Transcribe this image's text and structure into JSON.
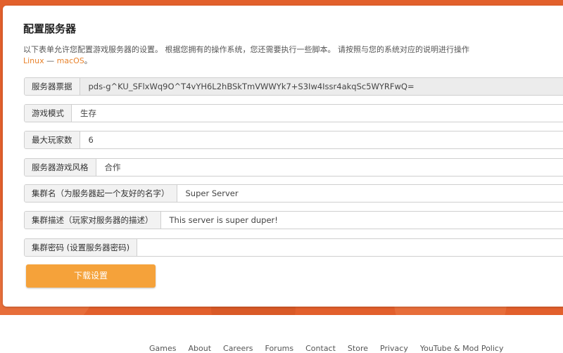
{
  "page": {
    "title": "配置服务器",
    "description": "以下表单允许您配置游戏服务器的设置。 根据您拥有的操作系统，您还需要执行一些脚本。 请按照与您的系统对应的说明进行操作",
    "os_links": [
      "Linux",
      "macOS"
    ],
    "os_separator": "—",
    "os_trailing": "。"
  },
  "form": {
    "fields": [
      {
        "label": "服务器票据",
        "value": "pds-g^KU_SFlxWq9O^T4vYH6L2hBSkTmVWWYk7+S3Iw4Issr4akqSc5WYRFwQ=",
        "readonly": true
      },
      {
        "label": "游戏模式",
        "value": "生存",
        "readonly": false
      },
      {
        "label": "最大玩家数",
        "value": "6",
        "readonly": false
      },
      {
        "label": "服务器游戏风格",
        "value": "合作",
        "readonly": false
      },
      {
        "label": "集群名（为服务器起一个友好的名字）",
        "value": "Super Server",
        "readonly": false
      },
      {
        "label": "集群描述（玩家对服务器的描述）",
        "value": "This server is super duper!",
        "readonly": false
      },
      {
        "label": "集群密码 (设置服务器密码)",
        "value": "",
        "readonly": false
      }
    ],
    "submit_label": "下载设置"
  },
  "footer": {
    "links": [
      "Games",
      "About",
      "Careers",
      "Forums",
      "Contact",
      "Store",
      "Privacy",
      "YouTube & Mod Policy"
    ]
  },
  "colors": {
    "background": "#e2602c",
    "accent_button": "#f5a23a",
    "link": "#e8822b"
  }
}
